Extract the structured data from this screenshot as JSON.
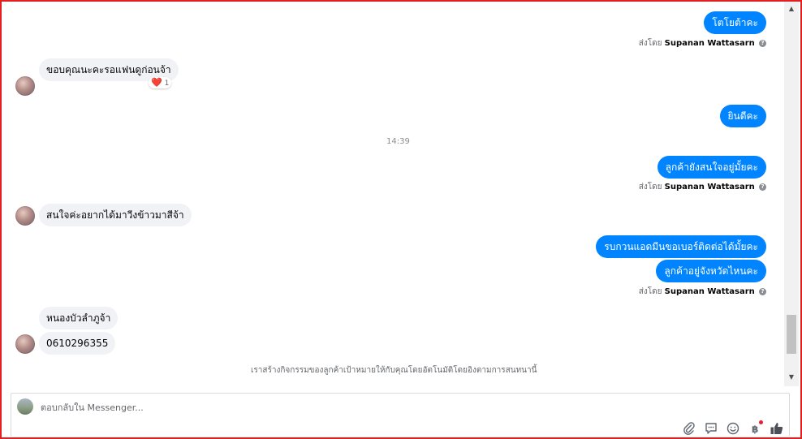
{
  "colors": {
    "outgoing_bubble": "#0084ff",
    "incoming_bubble": "#f0f2f5",
    "frame_border": "#e02020",
    "reaction_heart": "#e41e3f"
  },
  "messages": {
    "out_1": "โตโยต้าคะ",
    "in_1": "ขอบคุณนะคะรอแฟนดูก่อนจ้า",
    "in_1_reaction": {
      "emoji": "❤️",
      "count": "1"
    },
    "out_2": "ยินดีคะ",
    "timestamp": "14:39",
    "out_3": "ลูกค้ายังสนใจอยู่มั้ยคะ",
    "in_2": "สนใจค่ะอยากได้มาวีงข้าวมาสีจ้า",
    "out_4": "รบกวนแอดมีนขอเบอร์ติดต่อได้มั้ยคะ",
    "out_5": "ลูกค้าอยู่จังหวัดไหนคะ",
    "in_3": "หนองบัวลำภูจ้า",
    "in_4": "0610296355"
  },
  "sent_by": {
    "prefix": "ส่งโดย",
    "name": "Supanan Wattasarn"
  },
  "notice": "เราสร้างกิจกรรมของลูกค้าเป้าหมายให้กับคุณโดยอัตโนมัติโดยอิงตามการสนทนานี้",
  "composer": {
    "placeholder": "ตอบกลับใน Messenger..."
  },
  "icons": {
    "attach": "paperclip-icon",
    "saved_reply": "speech-bubble-icon",
    "emoji": "smiley-icon",
    "payment": "baht-icon",
    "like": "thumbs-up-icon",
    "scroll_up": "scroll-up-arrow-icon",
    "scroll_down": "scroll-down-arrow-icon"
  }
}
